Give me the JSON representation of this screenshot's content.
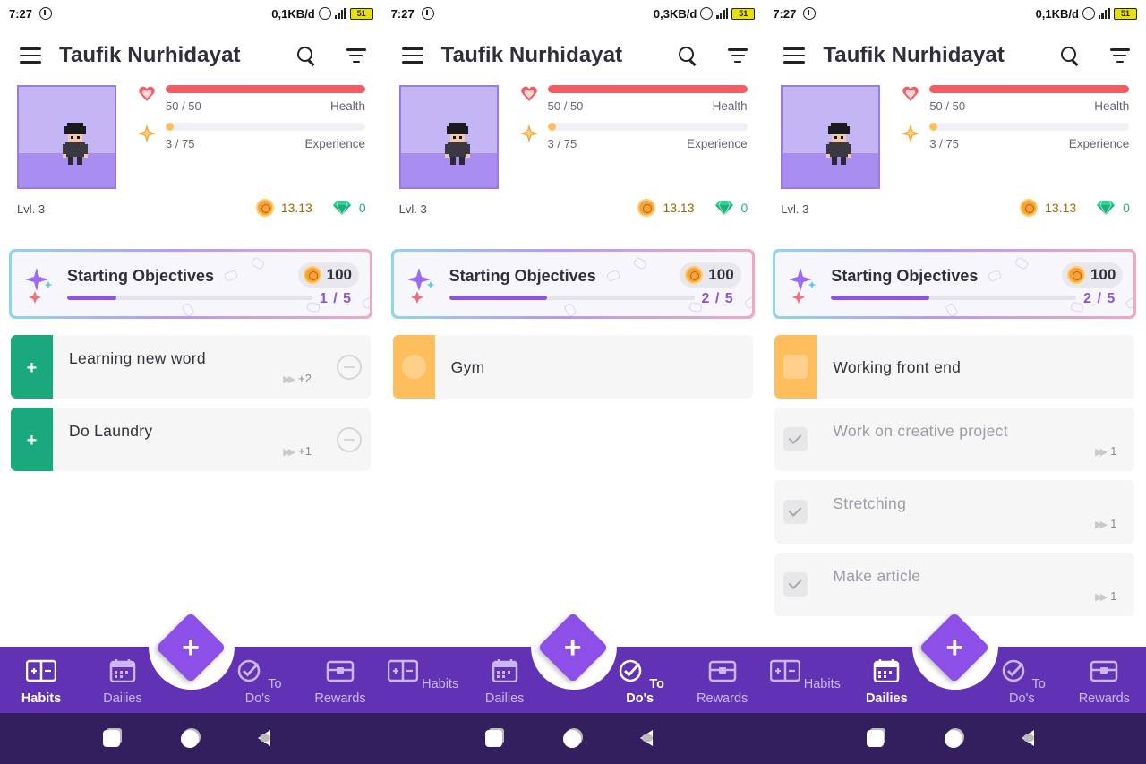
{
  "colors": {
    "accent": "#6133b4",
    "health": "#f55b60",
    "experience": "#ffbe5d",
    "habit_green": "#1aa97c",
    "todo_orange": "#ffbe5d",
    "gold": "#9c6a00",
    "gem": "#23b37f"
  },
  "screens": [
    {
      "status": {
        "time": "7:27",
        "speed": "0,1KB/d",
        "battery": "51"
      },
      "appbar": {
        "title": "Taufik Nurhidayat"
      },
      "stats": {
        "health_value": "50 / 50",
        "health_label": "Health",
        "health_fraction": 1.0,
        "exp_value": "3 / 75",
        "exp_label": "Experience",
        "exp_fraction": 0.04,
        "level": "Lvl. 3",
        "gold": "13.13",
        "gems": "0"
      },
      "objectives": {
        "title": "Starting Objectives",
        "reward": "100",
        "count": "1 / 5",
        "progress": 0.2
      },
      "tasks": [
        {
          "text": "Learning new word",
          "streak": "+2"
        },
        {
          "text": "Do Laundry",
          "streak": "+1"
        }
      ],
      "nav": {
        "active": "habits",
        "habits": "Habits",
        "dailies": "Dailies",
        "todos": "To Do's",
        "rewards": "Rewards"
      }
    },
    {
      "status": {
        "time": "7:27",
        "speed": "0,3KB/d",
        "battery": "51"
      },
      "appbar": {
        "title": "Taufik Nurhidayat"
      },
      "stats": {
        "health_value": "50 / 50",
        "health_label": "Health",
        "health_fraction": 1.0,
        "exp_value": "3 / 75",
        "exp_label": "Experience",
        "exp_fraction": 0.04,
        "level": "Lvl. 3",
        "gold": "13.13",
        "gems": "0"
      },
      "objectives": {
        "title": "Starting Objectives",
        "reward": "100",
        "count": "2 / 5",
        "progress": 0.4
      },
      "tasks": [
        {
          "text": "Gym"
        }
      ],
      "nav": {
        "active": "todos",
        "habits": "Habits",
        "dailies": "Dailies",
        "todos": "To Do's",
        "rewards": "Rewards"
      }
    },
    {
      "status": {
        "time": "7:27",
        "speed": "0,1KB/d",
        "battery": "51"
      },
      "appbar": {
        "title": "Taufik Nurhidayat"
      },
      "stats": {
        "health_value": "50 / 50",
        "health_label": "Health",
        "health_fraction": 1.0,
        "exp_value": "3 / 75",
        "exp_label": "Experience",
        "exp_fraction": 0.04,
        "level": "Lvl. 3",
        "gold": "13.13",
        "gems": "0"
      },
      "objectives": {
        "title": "Starting Objectives",
        "reward": "100",
        "count": "2 / 5",
        "progress": 0.4
      },
      "tasks": [
        {
          "text": "Working front end"
        },
        {
          "text": "Work on creative project",
          "streak": "1"
        },
        {
          "text": "Stretching",
          "streak": "1"
        },
        {
          "text": "Make article",
          "streak": "1"
        }
      ],
      "nav": {
        "active": "dailies",
        "habits": "Habits",
        "dailies": "Dailies",
        "todos": "To Do's",
        "rewards": "Rewards"
      }
    }
  ]
}
